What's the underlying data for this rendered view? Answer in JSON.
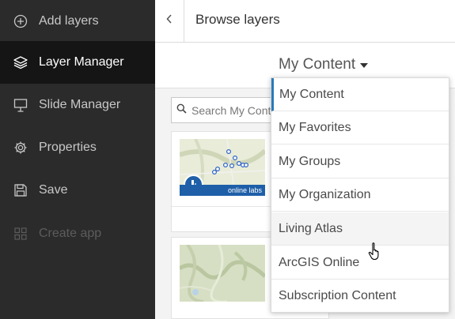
{
  "sidebar": {
    "items": [
      {
        "label": "Add layers",
        "icon": "plus-circle-icon",
        "active": false,
        "disabled": false
      },
      {
        "label": "Layer Manager",
        "icon": "layers-icon",
        "active": true,
        "disabled": false
      },
      {
        "label": "Slide Manager",
        "icon": "presentation-icon",
        "active": false,
        "disabled": false
      },
      {
        "label": "Properties",
        "icon": "gear-icon",
        "active": false,
        "disabled": false
      },
      {
        "label": "Save",
        "icon": "floppy-disk-icon",
        "active": false,
        "disabled": false
      },
      {
        "label": "Create app",
        "icon": "grid-icon",
        "active": false,
        "disabled": true
      }
    ]
  },
  "header": {
    "title": "Browse layers",
    "back_icon": "chevron-left-icon"
  },
  "scope": {
    "selected": "My Content",
    "options": [
      "My Content",
      "My Favorites",
      "My Groups",
      "My Organization",
      "Living Atlas",
      "ArcGIS Online",
      "Subscription Content"
    ],
    "hovered": "Living Atlas"
  },
  "search": {
    "placeholder": "Search My Content"
  },
  "cards": [
    {
      "badge_text": "online labs"
    }
  ],
  "colors": {
    "sidebar_bg": "#2b2b2b",
    "sidebar_active_bg": "#151515",
    "accent": "#2a7ab8",
    "badge_blue": "#1e5fa8"
  }
}
